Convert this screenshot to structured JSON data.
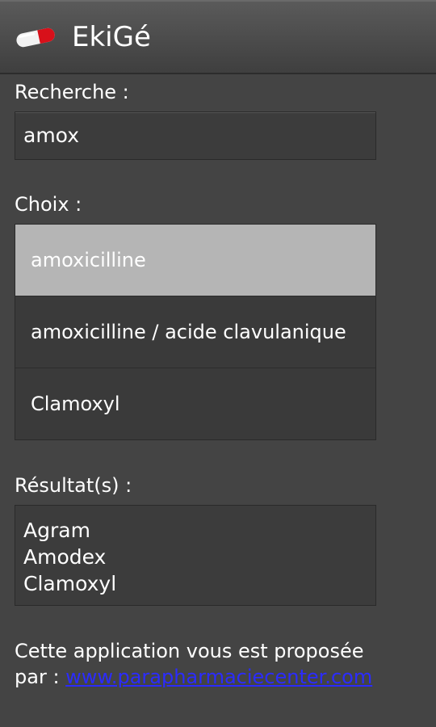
{
  "app": {
    "title": "EkiGé",
    "icon": "pill-icon"
  },
  "search": {
    "label": "Recherche :",
    "value": "amox"
  },
  "choices": {
    "label": "Choix :",
    "items": [
      {
        "label": "amoxicilline",
        "selected": true
      },
      {
        "label": "amoxicilline / acide clavulanique",
        "selected": false
      },
      {
        "label": "Clamoxyl",
        "selected": false
      }
    ]
  },
  "results": {
    "label": "Résultat(s) :",
    "items": [
      "Agram",
      "Amodex",
      "Clamoxyl"
    ]
  },
  "footer": {
    "text": "Cette application vous est proposée",
    "prefix": "par : ",
    "link": "www.parapharmaciecenter.com"
  },
  "colors": {
    "background": "#444444",
    "selected_item": "#b5b5b5",
    "link": "#2b2bff",
    "pill_red": "#d8101a"
  }
}
